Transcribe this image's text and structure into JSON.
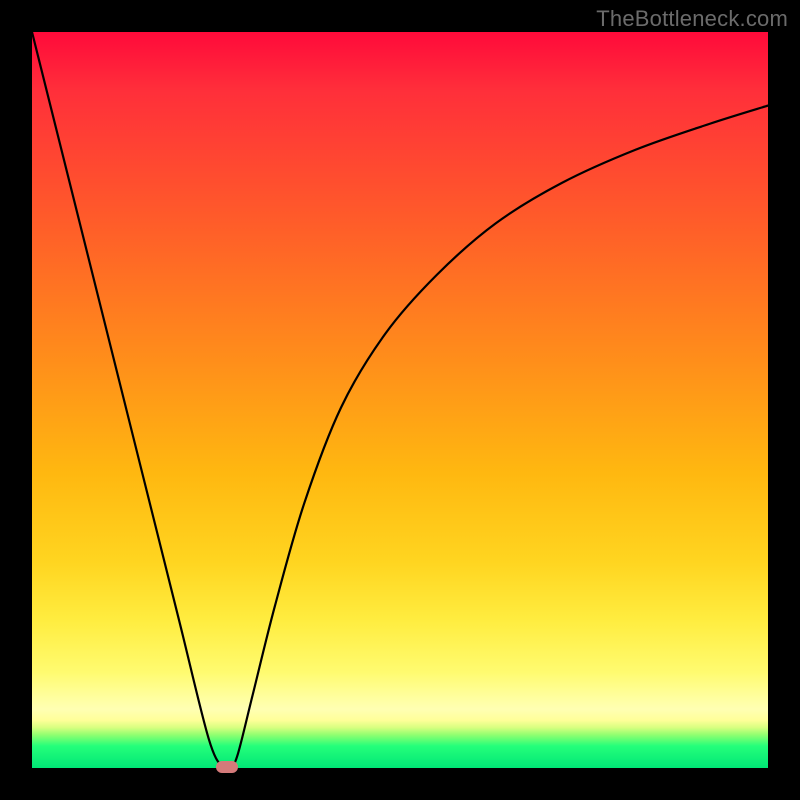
{
  "watermark": "TheBottleneck.com",
  "chart_data": {
    "type": "line",
    "title": "",
    "xlabel": "",
    "ylabel": "",
    "xlim": [
      0,
      100
    ],
    "ylim": [
      0,
      100
    ],
    "grid": false,
    "series": [
      {
        "name": "bottleneck-curve",
        "x": [
          0,
          5,
          10,
          15,
          20,
          24,
          26,
          27,
          28,
          30,
          33,
          37,
          42,
          48,
          55,
          63,
          72,
          82,
          92,
          100
        ],
        "values": [
          100,
          80,
          60,
          40,
          20,
          4,
          0,
          0,
          2,
          10,
          22,
          36,
          49,
          59,
          67,
          74,
          79.5,
          84,
          87.5,
          90
        ]
      }
    ],
    "marker": {
      "x": 26.5,
      "y": 0.2,
      "color": "#d47a7a"
    },
    "background_gradient": {
      "top": "#ff0a3a",
      "mid": "#ffd520",
      "bottom": "#00e676"
    }
  }
}
